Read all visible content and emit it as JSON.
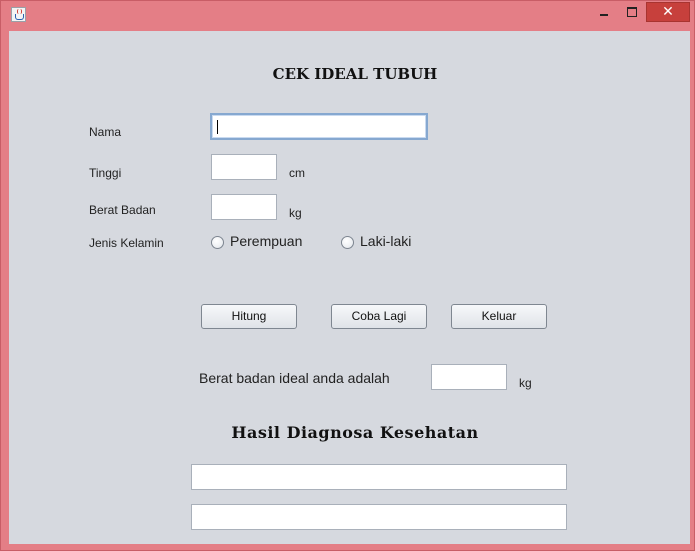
{
  "window": {
    "close_glyph": "✕"
  },
  "form": {
    "title": "CEK IDEAL TUBUH",
    "nama_label": "Nama",
    "nama_value": "",
    "tinggi_label": "Tinggi",
    "tinggi_value": "",
    "tinggi_unit": "cm",
    "berat_label": "Berat Badan",
    "berat_value": "",
    "berat_unit": "kg",
    "jenis_kelamin_label": "Jenis Kelamin",
    "radio_perempuan": "Perempuan",
    "radio_laki": "Laki-laki",
    "selected_gender": null
  },
  "buttons": {
    "hitung": "Hitung",
    "coba_lagi": "Coba Lagi",
    "keluar": "Keluar"
  },
  "result": {
    "ideal_label": "Berat badan ideal anda adalah",
    "ideal_value": "",
    "ideal_unit": "kg",
    "diagnosis_title": "Hasil Diagnosa Kesehatan",
    "diagnosis_line_1": "",
    "diagnosis_line_2": ""
  },
  "icons": {
    "app": "java-cup-icon",
    "minimize": "minimize-icon",
    "maximize": "maximize-icon",
    "close": "close-icon"
  },
  "colors": {
    "frame": "#e47e86",
    "client": "#d6d9df",
    "close_button": "#c7403c"
  }
}
